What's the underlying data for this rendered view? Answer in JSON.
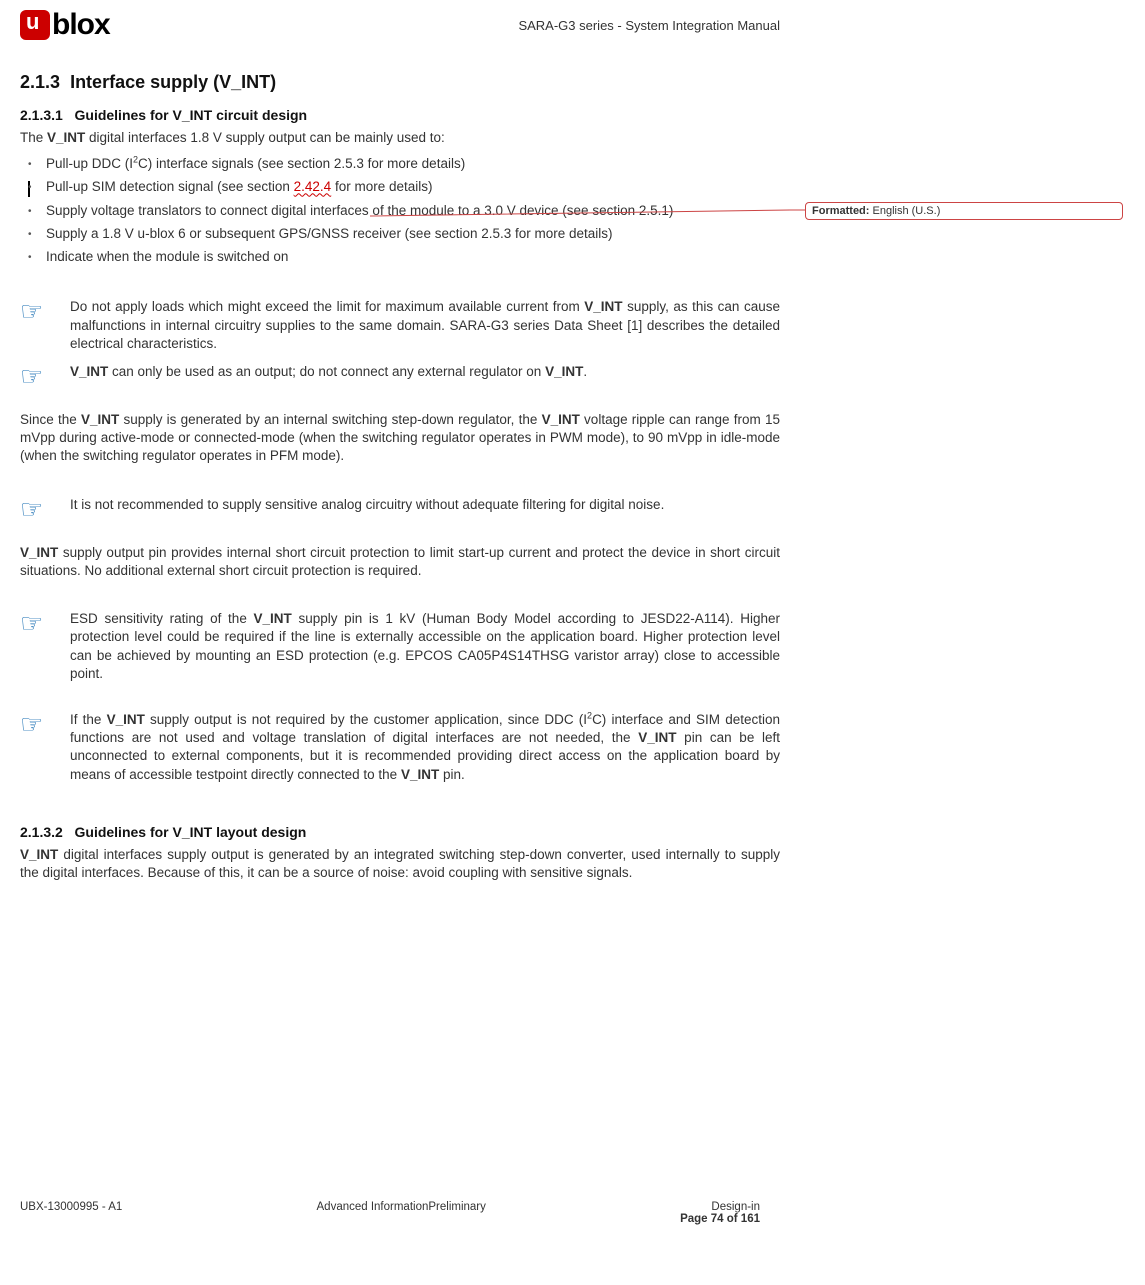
{
  "header": {
    "logo_text": "blox",
    "doc_title": "SARA-G3 series - System Integration Manual"
  },
  "section": {
    "num": "2.1.3",
    "title": "Interface supply (V_INT)"
  },
  "sub1": {
    "num": "2.1.3.1",
    "title": "Guidelines for V_INT circuit design"
  },
  "intro_prefix": "The ",
  "intro_bold": "V_INT",
  "intro_suffix": " digital interfaces 1.8 V supply output can be mainly used to:",
  "bullets": {
    "b1a": "Pull-up DDC (I",
    "b1b": "C) interface signals (see section 2.5.3 for more details)",
    "b2a": "Pull-up SIM detection signal (see section ",
    "b2red": "2.42.4",
    "b2b": " for more details)",
    "b3": "Supply voltage translators to connect digital interfaces of the module to a 3.0 V device (see section 2.5.1)",
    "b4": "Supply a 1.8 V u-blox 6 or subsequent GPS/GNSS receiver (see section 2.5.3 for more details)",
    "b5": "Indicate when the module is switched on"
  },
  "note1": {
    "a": "Do not apply loads which might exceed the limit for maximum available current from ",
    "b": "V_INT",
    "c": " supply, as this can cause malfunctions in internal circuitry supplies to the same domain. SARA-G3 series Data Sheet [1] describes the detailed electrical characteristics."
  },
  "note2": {
    "a": "V_INT",
    "b": " can only be used as an output; do not connect any external regulator on ",
    "c": "V_INT",
    "d": "."
  },
  "para1": {
    "a": "Since the ",
    "b": "V_INT",
    "c": " supply is generated by an internal switching step-down regulator, the ",
    "d": "V_INT",
    "e": " voltage ripple can range from 15 mVpp during active-mode or connected-mode (when the switching regulator operates in PWM mode), to 90 mVpp in idle-mode (when the switching regulator operates in PFM mode)."
  },
  "note3": "It is not recommended to supply sensitive analog circuitry without adequate filtering for digital noise.",
  "para2": {
    "a": "V_INT",
    "b": " supply output pin provides internal short circuit protection to limit start-up current and protect the device in short circuit situations. No additional external short circuit protection is required."
  },
  "note4": {
    "a": "ESD sensitivity rating of the ",
    "b": "V_INT",
    "c": " supply pin is 1 kV (Human Body Model according to JESD22-A114). Higher protection level could be required if the line is externally accessible on the application board. Higher protection level can be achieved by mounting an ESD protection (e.g. EPCOS CA05P4S14THSG varistor array) close to accessible point."
  },
  "note5": {
    "a": "If the ",
    "b": "V_INT",
    "c": " supply output is not required by the customer application, since DDC (I",
    "d": "C) interface and SIM detection functions are not used and voltage translation of digital interfaces are not needed, the ",
    "e": "V_INT",
    "f": " pin can be left unconnected to external components, but it is recommended providing direct access on the application board by means of accessible testpoint directly connected to the ",
    "g": "V_INT",
    "h": " pin."
  },
  "sub2": {
    "num": "2.1.3.2",
    "title": "Guidelines for V_INT layout design"
  },
  "para3": {
    "a": "V_INT",
    "b": " digital interfaces supply output is generated by an integrated switching step-down converter, used internally to supply the digital interfaces. Because of this, it can be a source of noise: avoid coupling with sensitive signals."
  },
  "footer": {
    "left": "UBX-13000995 - A1",
    "center": "Advanced InformationPreliminary",
    "right_line1": "Design-in",
    "right_line2": "Page 74 of 161"
  },
  "comment": {
    "label": "Formatted:",
    "value": " English (U.S.)"
  }
}
